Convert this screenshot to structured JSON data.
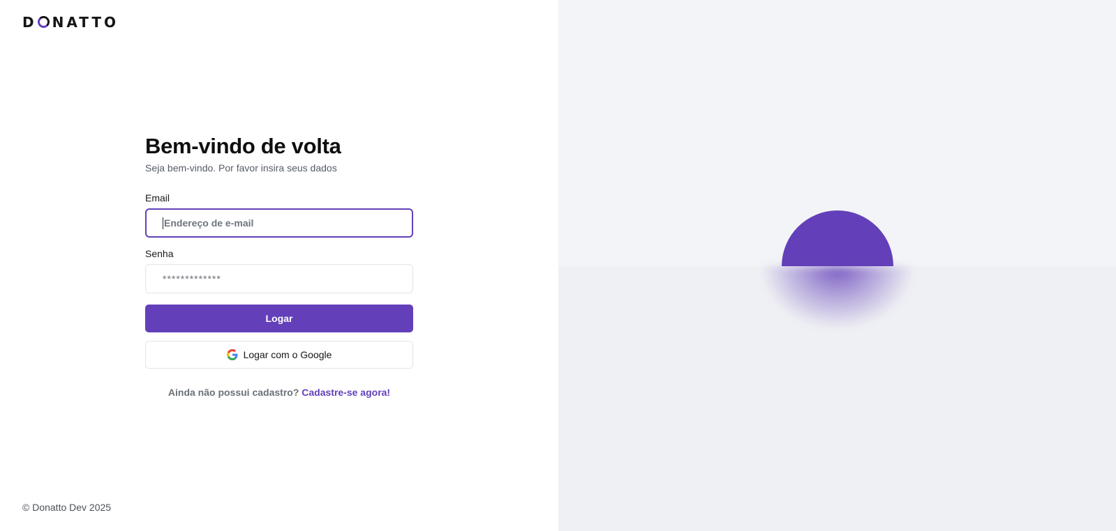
{
  "brand": {
    "name": "DONATTO",
    "name_prefix": "D",
    "name_suffix": "NATTO",
    "accent": "#6340b9"
  },
  "login": {
    "title": "Bem-vindo de volta",
    "subtitle": "Seja bem-vindo. Por favor insira seus dados",
    "email_label": "Email",
    "email_placeholder": "Endereço de e-mail",
    "password_label": "Senha",
    "password_value": "*************",
    "submit_label": "Logar",
    "google_label": "Logar com o Google",
    "google_icon": "google-icon",
    "signup_prompt": "Ainda não possui cadastro?",
    "signup_link": "Cadastre-se agora!"
  },
  "footer": {
    "copyright": "© Donatto Dev 2025"
  }
}
